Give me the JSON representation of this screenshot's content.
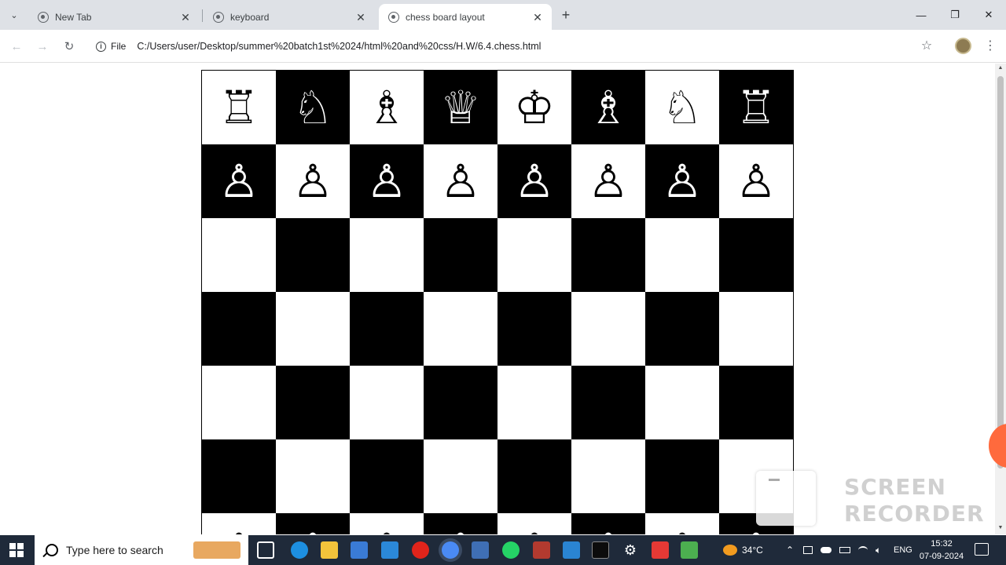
{
  "tabs": [
    {
      "title": "New Tab",
      "active": false
    },
    {
      "title": "keyboard",
      "active": false
    },
    {
      "title": "chess board layout",
      "active": true
    }
  ],
  "toolbar": {
    "file_label": "File",
    "url": "C:/Users/user/Desktop/summer%20batch1st%2024/html%20and%20css/H.W/6.4.chess.html"
  },
  "board": {
    "rows": [
      {
        "cells": [
          {
            "piece": "♖",
            "color": "w"
          },
          {
            "piece": "♘",
            "color": "b"
          },
          {
            "piece": "♗",
            "color": "w"
          },
          {
            "piece": "♕",
            "color": "b"
          },
          {
            "piece": "♔",
            "color": "w"
          },
          {
            "piece": "♗",
            "color": "b"
          },
          {
            "piece": "♘",
            "color": "w"
          },
          {
            "piece": "♖",
            "color": "b"
          }
        ]
      },
      {
        "cells": [
          {
            "piece": "♙",
            "color": "b"
          },
          {
            "piece": "♙",
            "color": "w"
          },
          {
            "piece": "♙",
            "color": "b"
          },
          {
            "piece": "♙",
            "color": "w"
          },
          {
            "piece": "♙",
            "color": "b"
          },
          {
            "piece": "♙",
            "color": "w"
          },
          {
            "piece": "♙",
            "color": "b"
          },
          {
            "piece": "♙",
            "color": "w"
          }
        ]
      },
      {
        "cells": [
          {
            "piece": "",
            "color": "w"
          },
          {
            "piece": "",
            "color": "b"
          },
          {
            "piece": "",
            "color": "w"
          },
          {
            "piece": "",
            "color": "b"
          },
          {
            "piece": "",
            "color": "w"
          },
          {
            "piece": "",
            "color": "b"
          },
          {
            "piece": "",
            "color": "w"
          },
          {
            "piece": "",
            "color": "b"
          }
        ]
      },
      {
        "cells": [
          {
            "piece": "",
            "color": "b"
          },
          {
            "piece": "",
            "color": "w"
          },
          {
            "piece": "",
            "color": "b"
          },
          {
            "piece": "",
            "color": "w"
          },
          {
            "piece": "",
            "color": "b"
          },
          {
            "piece": "",
            "color": "w"
          },
          {
            "piece": "",
            "color": "b"
          },
          {
            "piece": "",
            "color": "w"
          }
        ]
      },
      {
        "cells": [
          {
            "piece": "",
            "color": "w"
          },
          {
            "piece": "",
            "color": "b"
          },
          {
            "piece": "",
            "color": "w"
          },
          {
            "piece": "",
            "color": "b"
          },
          {
            "piece": "",
            "color": "w"
          },
          {
            "piece": "",
            "color": "b"
          },
          {
            "piece": "",
            "color": "w"
          },
          {
            "piece": "",
            "color": "b"
          }
        ]
      },
      {
        "cells": [
          {
            "piece": "",
            "color": "b"
          },
          {
            "piece": "",
            "color": "w"
          },
          {
            "piece": "",
            "color": "b"
          },
          {
            "piece": "",
            "color": "w"
          },
          {
            "piece": "",
            "color": "b"
          },
          {
            "piece": "",
            "color": "w"
          },
          {
            "piece": "",
            "color": "b"
          },
          {
            "piece": "",
            "color": "w"
          }
        ]
      },
      {
        "cells": [
          {
            "piece": "♙",
            "color": "w"
          },
          {
            "piece": "♙",
            "color": "b"
          },
          {
            "piece": "♙",
            "color": "w"
          },
          {
            "piece": "♙",
            "color": "b"
          },
          {
            "piece": "♙",
            "color": "w"
          },
          {
            "piece": "♙",
            "color": "b"
          },
          {
            "piece": "♙",
            "color": "w"
          },
          {
            "piece": "♙",
            "color": "b"
          }
        ]
      }
    ]
  },
  "watermark": {
    "line1": "SCREEN",
    "line2": "RECORDER"
  },
  "taskbar": {
    "search_placeholder": "Type here to search",
    "temperature": "34°C",
    "language": "ENG",
    "time": "15:32",
    "date": "07-09-2024"
  },
  "icons": {
    "tab_menu": "chevron-down-icon",
    "favicon": "globe-icon",
    "close": "close-icon",
    "new_tab": "plus-icon"
  }
}
